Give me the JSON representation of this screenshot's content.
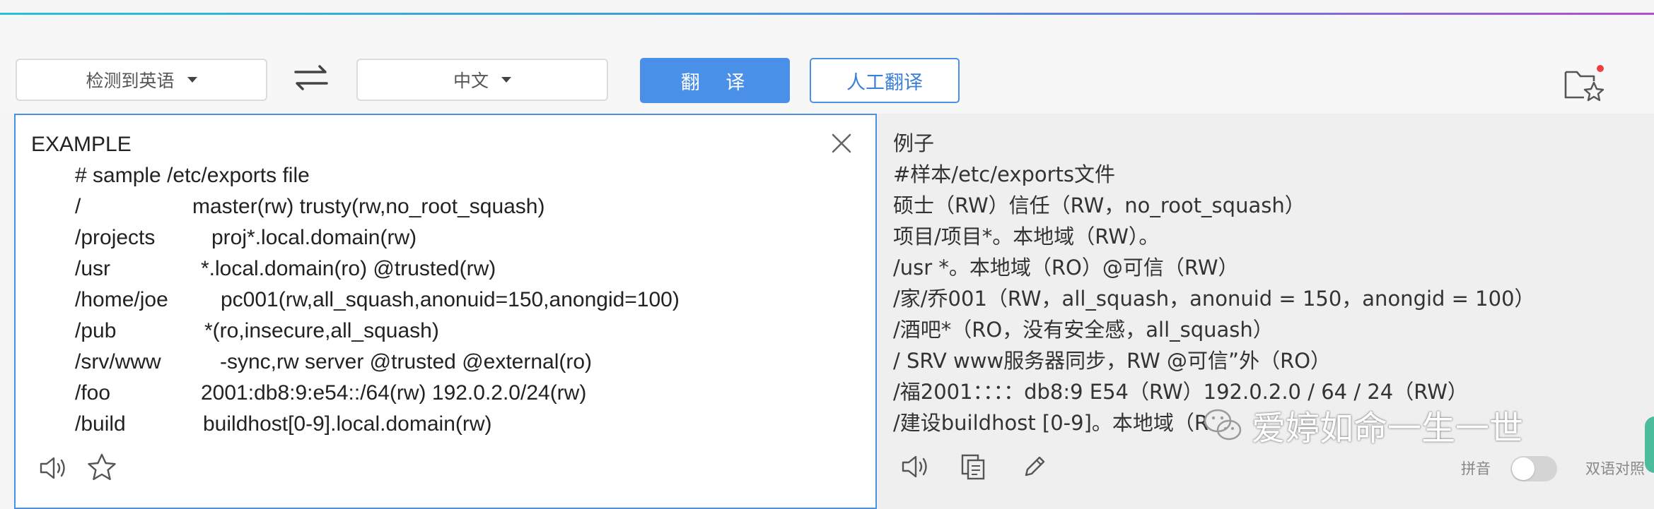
{
  "toolbar": {
    "source_lang": "检测到英语",
    "target_lang": "中文",
    "translate_label": "翻 译",
    "human_translate_label": "人工翻译"
  },
  "source": {
    "lines": [
      {
        "indent": false,
        "col1": "EXAMPLE",
        "col2": ""
      },
      {
        "indent": true,
        "col1": "# sample /etc/exports file",
        "col2": ""
      },
      {
        "indent": true,
        "col1": "/",
        "col2": "master(rw) trusty(rw,no_root_squash)"
      },
      {
        "indent": true,
        "col1": "/projects",
        "col2": "proj*.local.domain(rw)"
      },
      {
        "indent": true,
        "col1": "/usr",
        "col2": "*.local.domain(ro) @trusted(rw)"
      },
      {
        "indent": true,
        "col1": "/home/joe",
        "col2": "pc001(rw,all_squash,anonuid=150,anongid=100)"
      },
      {
        "indent": true,
        "col1": "/pub",
        "col2": "*(ro,insecure,all_squash)"
      },
      {
        "indent": true,
        "col1": "/srv/www",
        "col2": "-sync,rw server @trusted @external(ro)"
      },
      {
        "indent": true,
        "col1": "/foo",
        "col2": "2001:db8:9:e54::/64(rw) 192.0.2.0/24(rw)"
      },
      {
        "indent": true,
        "col1": "/build",
        "col2": "buildhost[0-9].local.domain(rw)"
      }
    ]
  },
  "target": {
    "lines": [
      "例子",
      "#样本/etc/exports文件",
      "硕士（RW）信任（RW，no_root_squash）",
      "项目/项目*。本地域（RW）。",
      "/usr *。本地域（RO）@可信（RW）",
      "/家/乔001（RW，all_squash，anonuid = 150，anongid = 100）",
      "/酒吧*（RO，没有安全感，all_squash）",
      "/ SRV www服务器同步，RW @可信”外（RO）",
      "/福2001：：：：db8:9 E54（RW）192.0.2.0 / 64 / 24（RW）",
      "/建设buildhost [0-9]。本地域（R"
    ],
    "pinyin_label": "拼音",
    "bilingual_label": "双语对照"
  },
  "watermark": {
    "text": "爱婷如命一生一世"
  },
  "icons": {
    "swap": "swap-arrows-icon",
    "favorites": "favorites-star-icon",
    "close": "close-icon",
    "speaker": "speaker-icon",
    "star": "star-icon",
    "copy": "copy-icon",
    "edit": "pencil-icon",
    "wechat": "wechat-icon"
  },
  "colors": {
    "accent": "#4a90e8",
    "notification": "#f04040"
  }
}
